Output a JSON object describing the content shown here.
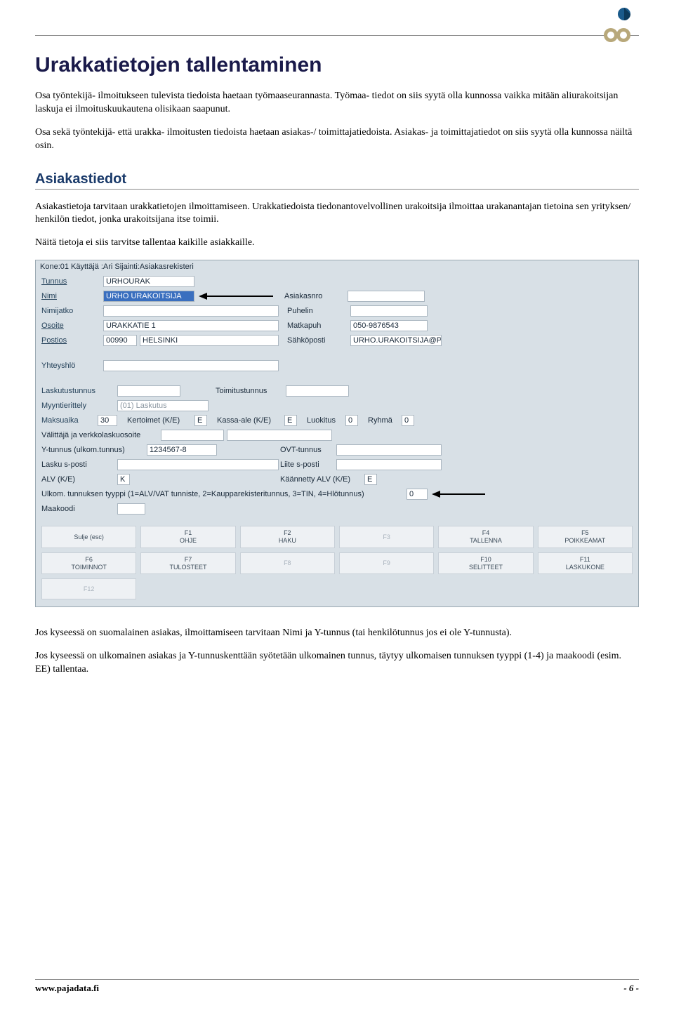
{
  "page": {
    "h1": "Urakkatietojen tallentaminen",
    "p1": "Osa työntekijä- ilmoitukseen tulevista tiedoista haetaan työmaaseurannasta. Työmaa- tiedot on siis syytä olla kunnossa vaikka mitään aliurakoitsijan laskuja ei ilmoituskuukautena olisikaan saapunut.",
    "p2": "Osa sekä työntekijä- että urakka- ilmoitusten tiedoista haetaan asiakas-/ toimittajatiedoista. Asiakas- ja toimittajatiedot on siis syytä olla kunnossa näiltä osin.",
    "h2": "Asiakastiedot",
    "p3": "Asiakastietoja tarvitaan urakkatietojen ilmoittamiseen. Urakkatiedoista tiedonantovelvollinen urakoitsija ilmoittaa urakanantajan tietoina sen yrityksen/ henkilön tiedot, jonka urakoitsijana itse toimii.",
    "p4": "Näitä tietoja ei siis tarvitse tallentaa kaikille asiakkaille.",
    "p5": "Jos kyseessä on suomalainen asiakas, ilmoittamiseen tarvitaan Nimi ja Y-tunnus (tai henkilötunnus jos ei ole Y-tunnusta).",
    "p6": "Jos kyseessä on ulkomainen asiakas ja Y-tunnuskenttään syötetään ulkomainen tunnus, täytyy ulkomaisen tunnuksen tyyppi (1-4) ja maakoodi (esim. EE) tallentaa."
  },
  "app": {
    "header": "Kone:01 Käyttäjä :Ari  Sijainti:Asiakasrekisteri",
    "labels": {
      "tunnus": "Tunnus",
      "nimi": "Nimi",
      "nimijatko": "Nimijatko",
      "osoite": "Osoite",
      "postios": "Postios",
      "asiakasnro": "Asiakasnro",
      "puhelin": "Puhelin",
      "matkapuh": "Matkapuh",
      "sahkoposti": "Sähköposti",
      "yhteyshlo": "Yhteyshlö",
      "laskutustunnus": "Laskutustunnus",
      "toimitustunnus": "Toimitustunnus",
      "myynterittely": "Myyntierittely",
      "maksuaika": "Maksuaika",
      "kertoimet": "Kertoimet (K/E)",
      "kassaale": "Kassa-ale (K/E)",
      "luokitus": "Luokitus",
      "ryhma": "Ryhmä",
      "valittaja": "Välittäjä ja verkkolaskuosoite",
      "ytunnus": "Y-tunnus (ulkom.tunnus)",
      "ovt": "OVT-tunnus",
      "laskusposti": "Lasku s-posti",
      "liitesposti": "Liite s-posti",
      "alv": "ALV (K/E)",
      "kaannetty": "Käännetty ALV (K/E)",
      "ulkom": "Ulkom. tunnuksen tyyppi (1=ALV/VAT tunniste, 2=Kaupparekisteritunnus, 3=TIN, 4=Hlötunnus)",
      "maakoodi": "Maakoodi"
    },
    "values": {
      "tunnus": "URHOURAK",
      "nimi": "URHO URAKOITSIJA",
      "osoite": "URAKKATIE 1",
      "postios1": "00990",
      "postios2": "HELSINKI",
      "matkapuh": "050-9876543",
      "sahkoposti": "URHO.URAKOITSIJA@PP.I",
      "myynterittely": "(01) Laskutus",
      "maksuaika": "30",
      "kertoimet": "E",
      "kassaale": "E",
      "luokitus": "0",
      "ryhma": "0",
      "ytunnus": "1234567-8",
      "alv": "K",
      "kaannetty": "E",
      "ulkom": "0"
    },
    "fkeys": [
      {
        "top": "",
        "bottom": "Sulje (esc)"
      },
      {
        "top": "F1",
        "bottom": "OHJE"
      },
      {
        "top": "F2",
        "bottom": "HAKU"
      },
      {
        "top": "F3",
        "bottom": ""
      },
      {
        "top": "F4",
        "bottom": "TALLENNA"
      },
      {
        "top": "F5",
        "bottom": "POIKKEAMAT"
      },
      {
        "top": "F6",
        "bottom": "TOIMINNOT"
      },
      {
        "top": "F7",
        "bottom": "TULOSTEET"
      },
      {
        "top": "F8",
        "bottom": ""
      },
      {
        "top": "F9",
        "bottom": ""
      },
      {
        "top": "F10",
        "bottom": "SELITTEET"
      },
      {
        "top": "F11",
        "bottom": "LASKUKONE"
      },
      {
        "top": "F12",
        "bottom": ""
      }
    ]
  },
  "footer": {
    "site": "www.pajadata.fi",
    "page": "- 6 -"
  }
}
